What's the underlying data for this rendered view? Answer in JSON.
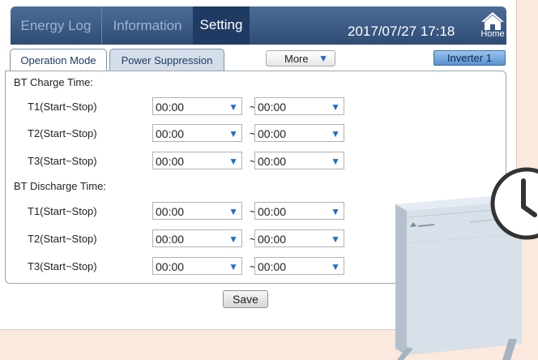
{
  "nav": {
    "tabs": [
      {
        "label": "Energy Log"
      },
      {
        "label": "Information"
      },
      {
        "label": "Setting"
      }
    ],
    "datetime": "2017/07/27 17:18",
    "home_label": "Home"
  },
  "subtabs": [
    {
      "label": "Operation Mode"
    },
    {
      "label": "Power Suppression"
    }
  ],
  "more_select": {
    "label": "More"
  },
  "inverter_button": {
    "label": "Inverter 1"
  },
  "charge": {
    "title": "BT Charge Time:",
    "rows": [
      {
        "label": "T1(Start~Stop)",
        "start": "00:00",
        "separator": "~",
        "stop": "00:00"
      },
      {
        "label": "T2(Start~Stop)",
        "start": "00:00",
        "separator": "~",
        "stop": "00:00"
      },
      {
        "label": "T3(Start~Stop)",
        "start": "00:00",
        "separator": "~",
        "stop": "00:00"
      }
    ]
  },
  "discharge": {
    "title": "BT Discharge Time:",
    "rows": [
      {
        "label": "T1(Start~Stop)",
        "start": "00:00",
        "separator": "~",
        "stop": "00:00"
      },
      {
        "label": "T2(Start~Stop)",
        "start": "00:00",
        "separator": "~",
        "stop": "00:00"
      },
      {
        "label": "T3(Start~Stop)",
        "start": "00:00",
        "separator": "~",
        "stop": "00:00"
      }
    ]
  },
  "save_label": "Save",
  "icons": {
    "dropdown_arrow": "triangle-down-icon",
    "home": "home-icon",
    "clock": "clock-icon"
  },
  "colors": {
    "nav_bar": "#2f4c75",
    "nav_active": "#1f3b64",
    "accent_arrow": "#1e6fc9",
    "page_background": "#fbe9dd"
  }
}
